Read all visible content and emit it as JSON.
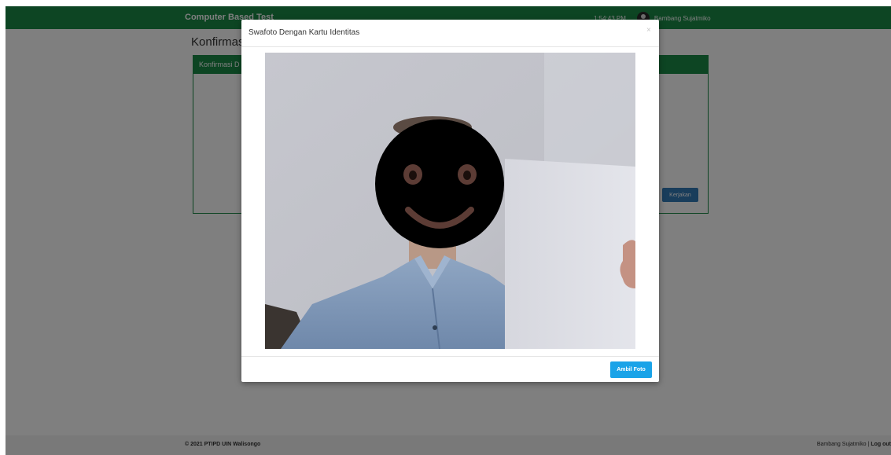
{
  "navbar": {
    "brand": "Computer Based Test",
    "time": "1:54:43 PM",
    "user_name": "Bambang Sujatmiko",
    "avatar_icon": "user-avatar-icon"
  },
  "page": {
    "title": "Konfirmasi",
    "panel_heading": "Konfirmasi D",
    "kerjakan_label": "Kerjakan"
  },
  "footer": {
    "copyright": "© 2021 PTIPD UIN Walisongo",
    "user_name": "Bambang Sujatmiko",
    "separator": "|",
    "logout_label": "Log out"
  },
  "modal": {
    "title": "Swafoto Dengan Kartu Identitas",
    "close_label": "×",
    "capture_label": "Ambil Foto"
  },
  "colors": {
    "brand_green": "#1a8a47",
    "primary_blue": "#337ab7",
    "info_blue": "#1aa3e8"
  }
}
